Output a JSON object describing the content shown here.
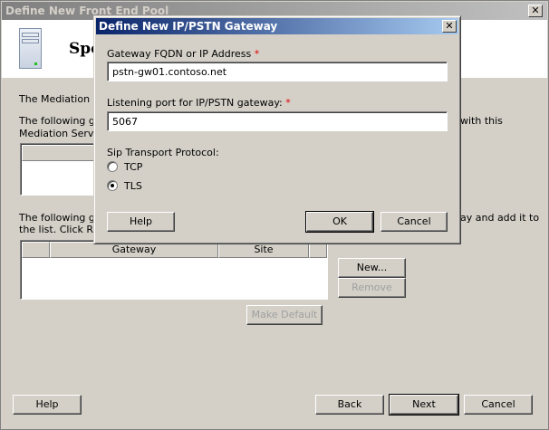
{
  "main_window": {
    "title": "Define New Front End Pool",
    "heading": "Spe",
    "line1": "The Mediation Se",
    "line2a": "The following gat",
    "line2b": "Mediation Server.",
    "line2c": "with this",
    "line3a": "The following gat",
    "line3b": "the list.  Click Re",
    "line3c": "ay and add it to",
    "table_columns": [
      "",
      "Gateway",
      "Site",
      ""
    ],
    "new_label": "New...",
    "remove_label": "Remove",
    "make_default_label": "Make Default",
    "help_label": "Help",
    "back_label": "Back",
    "next_label": "Next",
    "cancel_label": "Cancel"
  },
  "dialog": {
    "title": "Define New IP/PSTN Gateway",
    "fqdn_label": "Gateway FQDN or IP Address",
    "fqdn_value": "pstn-gw01.contoso.net",
    "port_label": "Listening port for IP/PSTN gateway:",
    "port_value": "5067",
    "required_mark": "*",
    "protocol_label": "Sip Transport Protocol:",
    "options": [
      {
        "label": "TCP",
        "selected": false
      },
      {
        "label": "TLS",
        "selected": true
      }
    ],
    "help_label": "Help",
    "ok_label": "OK",
    "cancel_label": "Cancel"
  }
}
